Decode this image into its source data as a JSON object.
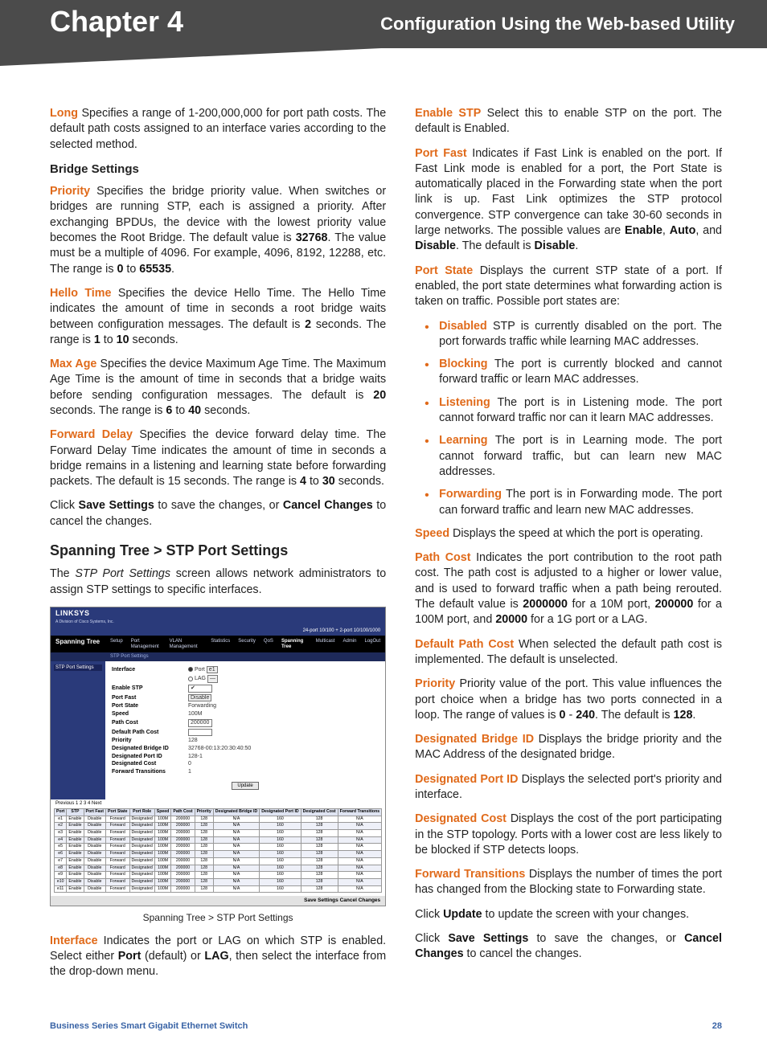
{
  "header": {
    "chapter": "Chapter 4",
    "subtitle": "Configuration Using the Web-based Utility"
  },
  "left": {
    "long_term": "Long",
    "long_body": "Specifies a range of 1-200,000,000 for port path costs. The default path costs assigned to an interface varies according to the selected method.",
    "bridge_heading": "Bridge Settings",
    "priority_term": "Priority",
    "priority_body_a": "Specifies the bridge priority value. When switches or bridges are running STP, each is assigned a priority. After exchanging BPDUs, the device with the lowest priority value becomes the Root Bridge. The default value is ",
    "priority_def": "32768",
    "priority_body_b": ". The value must be a multiple of 4096. For example, 4096, 8192, 12288, etc. The range is ",
    "priority_min": "0",
    "priority_to": " to ",
    "priority_max": "65535",
    "priority_end": ".",
    "hello_term": "Hello Time",
    "hello_body_a": "Specifies the device Hello Time. The Hello Time indicates the amount of time in seconds a root bridge waits between configuration messages. The default is ",
    "hello_def": "2",
    "hello_body_b": " seconds. The range is ",
    "hello_min": "1",
    "hello_to": " to ",
    "hello_max": "10",
    "hello_end": " seconds.",
    "maxage_term": "Max Age",
    "maxage_body_a": "Specifies the device Maximum Age Time. The Maximum Age Time is the amount of time in seconds that a bridge waits before sending configuration messages. The default is ",
    "maxage_def": "20",
    "maxage_body_b": " seconds. The range is ",
    "maxage_min": "6",
    "maxage_to": " to ",
    "maxage_max": "40",
    "maxage_end": " seconds.",
    "fdelay_term": "Forward Delay",
    "fdelay_body_a": "Specifies the device forward delay time. The Forward Delay Time indicates the amount of time in seconds a bridge remains in a listening and learning state before forwarding packets. The default is 15 seconds. The range is ",
    "fdelay_min": "4",
    "fdelay_to": " to ",
    "fdelay_max": "30",
    "fdelay_end": " seconds.",
    "save_a": "Click ",
    "save_b": "Save Settings",
    "save_c": " to save the changes, or ",
    "save_d": "Cancel Changes",
    "save_e": " to cancel the changes.",
    "section": "Spanning Tree > STP Port Settings",
    "section_intro_a": "The ",
    "section_intro_i": "STP Port Settings",
    "section_intro_b": " screen allows network administrators to assign STP settings to specific interfaces.",
    "figcaption": "Spanning Tree > STP Port Settings",
    "iface_term": "Interface",
    "iface_body_a": "Indicates the port or LAG on which STP is enabled. Select either ",
    "iface_port": "Port",
    "iface_body_b": " (default) or ",
    "iface_lag": "LAG",
    "iface_body_c": ", then select the interface from the drop-down menu."
  },
  "right": {
    "enable_term": "Enable STP",
    "enable_body": "Select this to enable STP on the port. The default is Enabled.",
    "portfast_term": "Port Fast",
    "portfast_body_a": "Indicates if Fast Link is enabled on the port. If Fast Link mode is enabled for a port, the Port State is automatically placed in the Forwarding state when the port link is up. Fast Link optimizes the STP protocol convergence. STP convergence can take 30-60 seconds in large networks. The possible values are ",
    "pf_enable": "Enable",
    "pf_comma1": ", ",
    "pf_auto": "Auto",
    "pf_comma2": ", and ",
    "pf_disable": "Disable",
    "pf_end": ". The default is ",
    "pf_default": "Disable",
    "pf_period": ".",
    "portstate_term": "Port State",
    "portstate_body": "Displays the current STP state of a port. If enabled, the port state determines what forwarding action is taken on traffic. Possible port states are:",
    "states": {
      "disabled_t": "Disabled",
      "disabled_b": "STP is currently disabled on the port. The port forwards traffic while learning MAC addresses.",
      "blocking_t": "Blocking",
      "blocking_b": "The port is currently blocked and cannot forward traffic or learn MAC addresses.",
      "listening_t": "Listening",
      "listening_b": "The port is in Listening mode. The port cannot forward traffic nor can it learn MAC addresses.",
      "learning_t": "Learning",
      "learning_b": "The port is in Learning mode. The port cannot forward traffic, but can learn new MAC addresses.",
      "forwarding_t": "Forwarding",
      "forwarding_b": "The port is in Forwarding mode. The port can forward traffic and learn new MAC addresses."
    },
    "speed_term": "Speed",
    "speed_body": "Displays the speed at which the port is operating.",
    "pathcost_term": "Path Cost",
    "pathcost_body_a": "Indicates the port contribution to the root path cost. The path cost is adjusted to a higher or lower value, and is used to forward traffic when a path being rerouted. The default value is ",
    "pc_10m": "2000000",
    "pc_body_b": " for a 10M port, ",
    "pc_100m": "200000",
    "pc_body_c": " for a 100M port, and ",
    "pc_1g": "20000",
    "pc_body_d": " for a 1G port or a LAG.",
    "defpath_term": "Default Path Cost",
    "defpath_body": "When selected the default path cost is implemented. The default is unselected.",
    "priority_term": "Priority",
    "priority_body_a": "Priority value of the port. This value influences the port choice when a bridge has two ports connected in a loop. The range of values is ",
    "pr_min": "0",
    "pr_dash": " - ",
    "pr_max": "240",
    "pr_body_b": ". The default is ",
    "pr_def": "128",
    "pr_end": ".",
    "dbid_term": "Designated Bridge ID",
    "dbid_body": "Displays the bridge priority and the MAC Address of the designated bridge.",
    "dpid_term": "Designated Port ID",
    "dpid_body": "Displays the selected port's priority and interface.",
    "dcost_term": "Designated Cost",
    "dcost_body": "Displays the cost of the port participating in the STP topology. Ports with a lower cost are less likely to be blocked if STP detects loops.",
    "ftrans_term": "Forward Transitions",
    "ftrans_body": "Displays the number of times the port has changed from the Blocking state to Forwarding state.",
    "update_a": "Click ",
    "update_b": "Update",
    "update_c": " to update the screen with your changes.",
    "save_a": "Click ",
    "save_b": "Save Settings",
    "save_c": " to save the changes, or ",
    "save_d": "Cancel Changes",
    "save_e": " to cancel the changes."
  },
  "shot": {
    "brand": "LINKSYS",
    "subbrand": "A Division of Cisco Systems, Inc.",
    "topright": "24-port 10/100 + 2-port 10/100/1000",
    "navlabel": "Spanning Tree",
    "tabs": [
      "Setup",
      "Port Management",
      "VLAN Management",
      "Statistics",
      "Security",
      "QoS",
      "Spanning Tree",
      "Multicast",
      "Admin",
      "LogOut"
    ],
    "subnav": "STP Port Settings",
    "leftnav": "STP Port Settings",
    "form": {
      "interface": "Interface",
      "iface_port": "Port",
      "iface_portval": "e1",
      "iface_lag": "LAG",
      "enable_stp": "Enable STP",
      "portfast": "Port Fast",
      "portfast_val": "Disable",
      "portstate": "Port State",
      "portstate_val": "Forwarding",
      "speed": "Speed",
      "speed_val": "100M",
      "pathcost": "Path Cost",
      "pathcost_val": "200000",
      "defpath": "Default Path Cost",
      "priority": "Priority",
      "priority_val": "128",
      "dbid": "Designated Bridge ID",
      "dbid_val": "32768-00:13:20:30:40:50",
      "dpid": "Designated Port ID",
      "dpid_val": "128-1",
      "dcost": "Designated Cost",
      "dcost_val": "0",
      "ftrans": "Forward Transitions",
      "ftrans_val": "1",
      "update_btn": "Update"
    },
    "pager_label": "Previous   1  2  3  4    Next",
    "table": {
      "headers": [
        "Port",
        "STP",
        "Port Fast",
        "Port State",
        "Port Role",
        "Speed",
        "Path Cost",
        "Priority",
        "Designated Bridge ID",
        "Designated Port ID",
        "Designated Cost",
        "Forward Transitions"
      ],
      "rows": [
        [
          "e1",
          "Enable",
          "Disable",
          "Forward",
          "Designated",
          "100M",
          "200000",
          "128",
          "N/A",
          "160",
          "128",
          "N/A"
        ],
        [
          "e2",
          "Enable",
          "Disable",
          "Forward",
          "Designated",
          "100M",
          "200000",
          "128",
          "N/A",
          "160",
          "128",
          "N/A"
        ],
        [
          "e3",
          "Enable",
          "Disable",
          "Forward",
          "Designated",
          "100M",
          "200000",
          "128",
          "N/A",
          "160",
          "128",
          "N/A"
        ],
        [
          "e4",
          "Enable",
          "Disable",
          "Forward",
          "Designated",
          "100M",
          "200000",
          "128",
          "N/A",
          "160",
          "128",
          "N/A"
        ],
        [
          "e5",
          "Enable",
          "Disable",
          "Forward",
          "Designated",
          "100M",
          "200000",
          "128",
          "N/A",
          "160",
          "128",
          "N/A"
        ],
        [
          "e6",
          "Enable",
          "Disable",
          "Forward",
          "Designated",
          "100M",
          "200000",
          "128",
          "N/A",
          "160",
          "128",
          "N/A"
        ],
        [
          "e7",
          "Enable",
          "Disable",
          "Forward",
          "Designated",
          "100M",
          "200000",
          "128",
          "N/A",
          "160",
          "128",
          "N/A"
        ],
        [
          "e8",
          "Enable",
          "Disable",
          "Forward",
          "Designated",
          "100M",
          "200000",
          "128",
          "N/A",
          "160",
          "128",
          "N/A"
        ],
        [
          "e9",
          "Enable",
          "Disable",
          "Forward",
          "Designated",
          "100M",
          "200000",
          "128",
          "N/A",
          "160",
          "128",
          "N/A"
        ],
        [
          "e10",
          "Enable",
          "Disable",
          "Forward",
          "Designated",
          "100M",
          "200000",
          "128",
          "N/A",
          "160",
          "128",
          "N/A"
        ],
        [
          "e11",
          "Enable",
          "Disable",
          "Forward",
          "Designated",
          "100M",
          "200000",
          "128",
          "N/A",
          "160",
          "128",
          "N/A"
        ]
      ]
    },
    "saverow": "Save Settings   Cancel Changes"
  },
  "footer": {
    "left": "Business Series Smart Gigabit Ethernet Switch",
    "right": "28"
  }
}
